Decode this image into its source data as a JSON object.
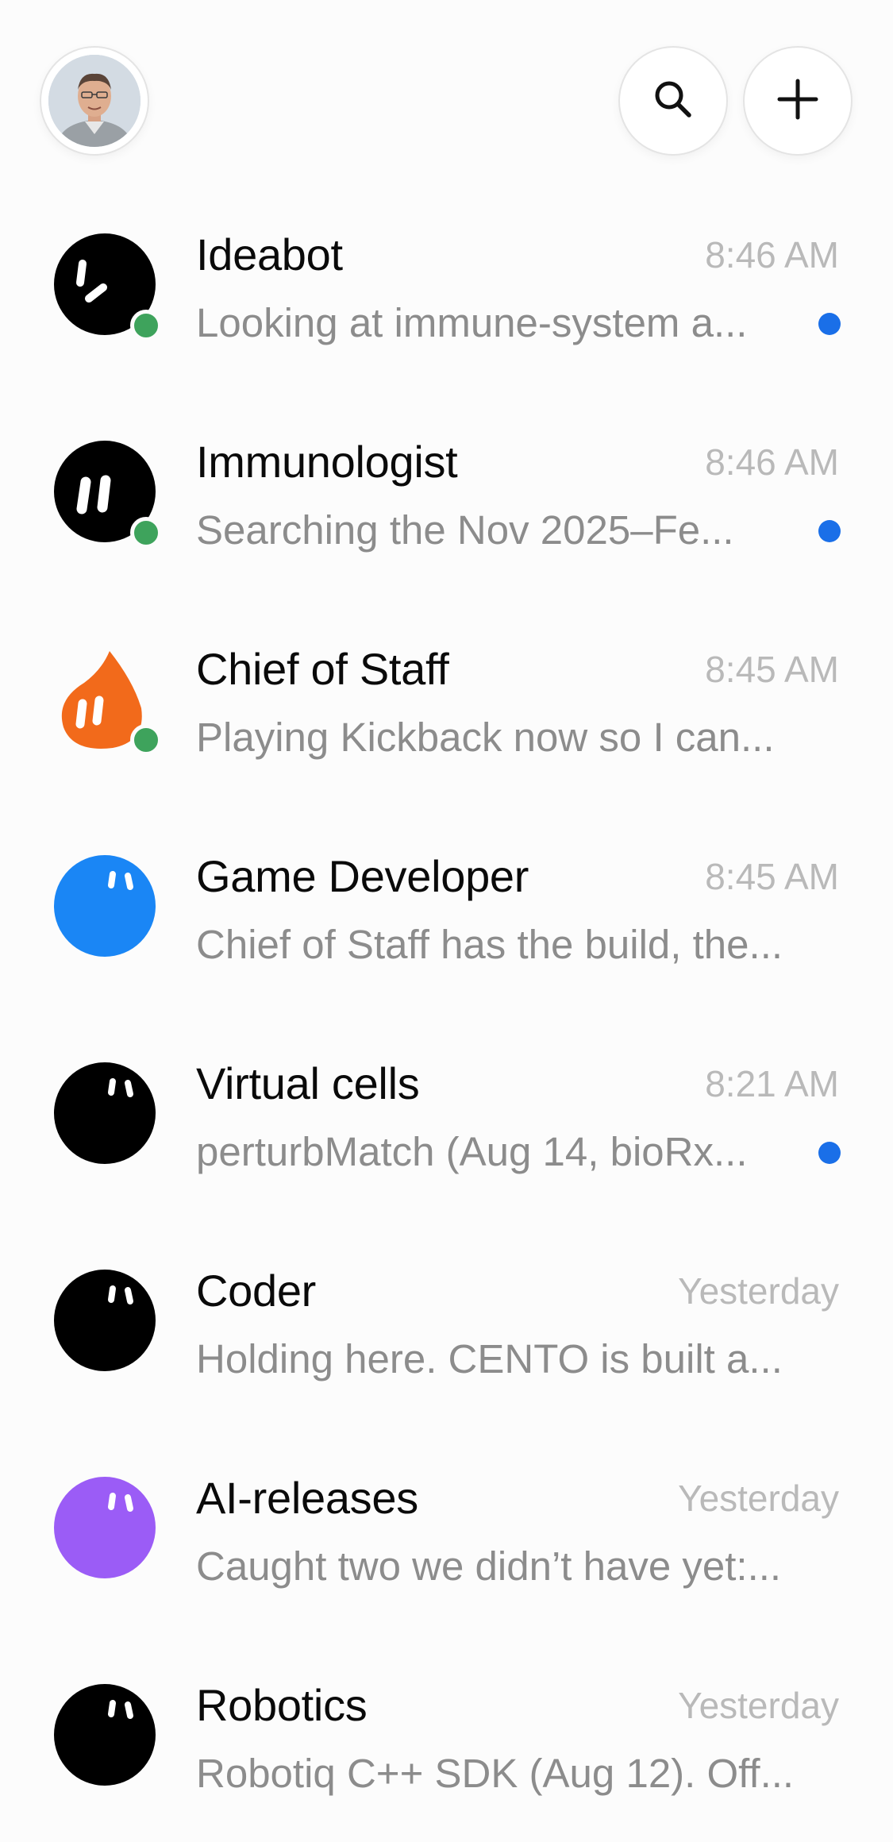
{
  "header": {
    "avatar_icon": "user-avatar-photo",
    "search_icon": "search-icon",
    "new_icon": "plus-icon"
  },
  "colors": {
    "online": "#3ea35c",
    "unread": "#1a6fe8",
    "blue_avatar": "#1a86f5",
    "purple_avatar": "#9b5cf6",
    "orange_avatar": "#f26a1b"
  },
  "conversations": [
    {
      "name": "Ideabot",
      "time": "8:46 AM",
      "preview": "Looking at immune-system a...",
      "avatar": "black-blob-smirk",
      "online": true,
      "unread": true
    },
    {
      "name": "Immunologist",
      "time": "8:46 AM",
      "preview": "Searching the Nov 2025–Fe...",
      "avatar": "black-blob-eyes-large",
      "online": true,
      "unread": true
    },
    {
      "name": "Chief of Staff",
      "time": "8:45 AM",
      "preview": "Playing Kickback now so I can...",
      "avatar": "orange-drop",
      "online": true,
      "unread": false
    },
    {
      "name": "Game Developer",
      "time": "8:45 AM",
      "preview": "Chief of Staff has the build, the...",
      "avatar": "blue-blob",
      "online": false,
      "unread": false
    },
    {
      "name": "Virtual cells",
      "time": "8:21 AM",
      "preview": "perturbMatch (Aug 14, bioRx...",
      "avatar": "black-blob",
      "online": false,
      "unread": true
    },
    {
      "name": "Coder",
      "time": "Yesterday",
      "preview": "Holding here. CENTO is built a...",
      "avatar": "black-blob",
      "online": false,
      "unread": false
    },
    {
      "name": "AI-releases",
      "time": "Yesterday",
      "preview": "Caught two we didn’t have yet:...",
      "avatar": "purple-blob",
      "online": false,
      "unread": false
    },
    {
      "name": "Robotics",
      "time": "Yesterday",
      "preview": "Robotiq C++ SDK (Aug 12). Off...",
      "avatar": "black-blob",
      "online": false,
      "unread": false
    }
  ]
}
